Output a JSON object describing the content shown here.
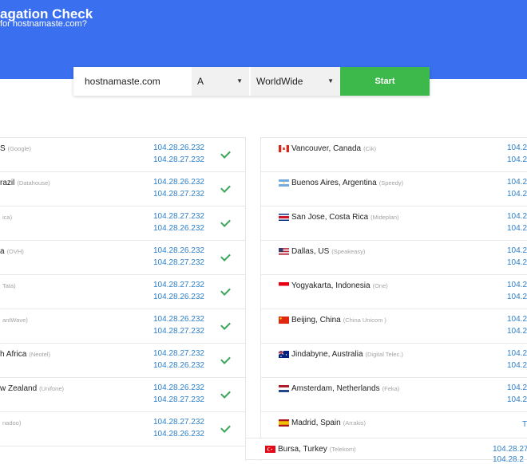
{
  "header": {
    "title": "agation Check",
    "subtitle": "for hostnamaste.com?"
  },
  "toolbar": {
    "domain_value": "hostnamaste.com",
    "record_type": "A",
    "region": "WorldWide",
    "start_label": "Start"
  },
  "colors": {
    "hero": "#3a6ff0",
    "start": "#3db84a",
    "ip": "#2d7fc9",
    "check": "#3ba55c"
  },
  "results_left": [
    {
      "location": "S",
      "provider": "(Google)",
      "ip1": "104.28.26.232",
      "ip2": "104.28.27.232"
    },
    {
      "location": "razil",
      "provider": "(Datahouse)",
      "ip1": "104.28.26.232",
      "ip2": "104.28.27.232"
    },
    {
      "location": "",
      "provider": "ica)",
      "ip1": "104.28.27.232",
      "ip2": "104.28.26.232"
    },
    {
      "location": "a",
      "provider": "(OVH)",
      "ip1": "104.28.26.232",
      "ip2": "104.28.27.232"
    },
    {
      "location": "",
      "provider": "Tata)",
      "ip1": "104.28.27.232",
      "ip2": "104.28.26.232"
    },
    {
      "location": "",
      "provider": "antWave)",
      "ip1": "104.28.26.232",
      "ip2": "104.28.27.232"
    },
    {
      "location": "h Africa",
      "provider": "(Neotel)",
      "ip1": "104.28.27.232",
      "ip2": "104.28.26.232"
    },
    {
      "location": "w Zealand",
      "provider": "(Unifone)",
      "ip1": "104.28.26.232",
      "ip2": "104.28.27.232"
    },
    {
      "location": "",
      "provider": "nadoo)",
      "ip1": "104.28.27.232",
      "ip2": "104.28.26.232"
    }
  ],
  "results_right": [
    {
      "flag": "canada-flag",
      "location": "Vancouver, Canada",
      "provider": "(Cik)",
      "ip1": "104.2",
      "ip2": "104.2"
    },
    {
      "flag": "argentina-flag",
      "location": "Buenos Aires, Argentina",
      "provider": "(Speedy)",
      "ip1": "104.2",
      "ip2": "104.2"
    },
    {
      "flag": "costa-rica-flag",
      "location": "San Jose, Costa Rica",
      "provider": "(Mideplan)",
      "ip1": "104.2",
      "ip2": "104.2"
    },
    {
      "flag": "us-flag",
      "location": "Dallas, US",
      "provider": "(Speakeasy)",
      "ip1": "104.2",
      "ip2": "104.2"
    },
    {
      "flag": "indonesia-flag",
      "location": "Yogyakarta, Indonesia",
      "provider": "(One)",
      "ip1": "104.2",
      "ip2": "104.2"
    },
    {
      "flag": "china-flag",
      "location": "Beijing, China",
      "provider": "(China Unicom )",
      "ip1": "104.2",
      "ip2": "104.2"
    },
    {
      "flag": "australia-flag",
      "location": "Jindabyne, Australia",
      "provider": "(Digital Telec.)",
      "ip1": "104.2",
      "ip2": "104.2"
    },
    {
      "flag": "netherlands-flag",
      "location": "Amsterdam, Netherlands",
      "provider": "(Feka)",
      "ip1": "104.2",
      "ip2": "104.2"
    },
    {
      "flag": "spain-flag",
      "location": "Madrid, Spain",
      "provider": "(Arrakis)",
      "ip1": "T",
      "ip2": ""
    },
    {
      "flag": "turkey-flag",
      "location": "Bursa, Turkey",
      "provider": "(Telekom)",
      "ip1": "104.28.27",
      "ip2": "104.28.2"
    }
  ]
}
